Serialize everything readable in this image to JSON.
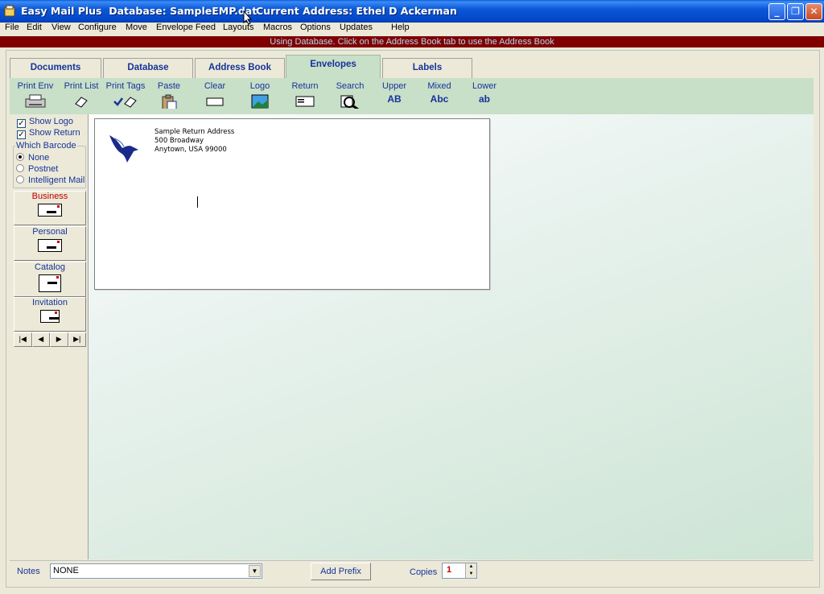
{
  "window": {
    "title": "Easy Mail Plus  Database: SampleEMP.dat",
    "current_address": "Current Address: Ethel D Ackerman",
    "controls": {
      "minimize": "_",
      "maximize": "❐",
      "close": "✕"
    }
  },
  "menu": [
    "File",
    "Edit",
    "View",
    "Configure",
    "Move",
    "Envelope Feed",
    "Layouts",
    "Macros",
    "Options",
    "Updates",
    "Help"
  ],
  "status_message": "Using Database. Click on the Address Book tab to use the Address Book",
  "tabs": [
    {
      "label": "Documents",
      "active": false
    },
    {
      "label": "Database",
      "active": false
    },
    {
      "label": "Address Book",
      "active": false
    },
    {
      "label": "Envelopes",
      "active": true
    },
    {
      "label": "Labels",
      "active": false
    }
  ],
  "toolbar": [
    {
      "label": "Print Env",
      "icon": "printer-icon"
    },
    {
      "label": "Print List",
      "icon": "list-icon"
    },
    {
      "label": "Print Tags",
      "icon": "tags-icon"
    },
    {
      "label": "Paste",
      "icon": "clipboard-icon"
    },
    {
      "label": "Clear",
      "icon": "clear-icon"
    },
    {
      "label": "Logo",
      "icon": "picture-icon"
    },
    {
      "label": "Return",
      "icon": "return-address-icon"
    },
    {
      "label": "Search",
      "icon": "magnifier-icon"
    },
    {
      "label": "Upper",
      "icon_text": "AB"
    },
    {
      "label": "Mixed",
      "icon_text": "Abc"
    },
    {
      "label": "Lower",
      "icon_text": "ab"
    }
  ],
  "left": {
    "show_logo": {
      "label": "Show Logo",
      "checked": true
    },
    "show_return": {
      "label": "Show Return",
      "checked": true
    },
    "barcode_group": "Which Barcode",
    "barcode_options": [
      {
        "label": "None",
        "selected": true
      },
      {
        "label": "Postnet",
        "selected": false
      },
      {
        "label": "Intelligent Mail",
        "selected": false
      }
    ],
    "envelope_types": [
      {
        "label": "Business",
        "selected": true
      },
      {
        "label": "Personal",
        "selected": false
      },
      {
        "label": "Catalog",
        "selected": false
      },
      {
        "label": "Invitation",
        "selected": false
      }
    ],
    "nav": [
      "|◀",
      "◀",
      "▶",
      "▶|"
    ]
  },
  "envelope": {
    "return_address": [
      "Sample Return Address",
      "500 Broadway",
      "Anytown, USA  99000"
    ]
  },
  "bottom": {
    "notes_label": "Notes",
    "notes_value": "NONE",
    "add_prefix": "Add Prefix",
    "copies_label": "Copies",
    "copies_value": "1"
  }
}
